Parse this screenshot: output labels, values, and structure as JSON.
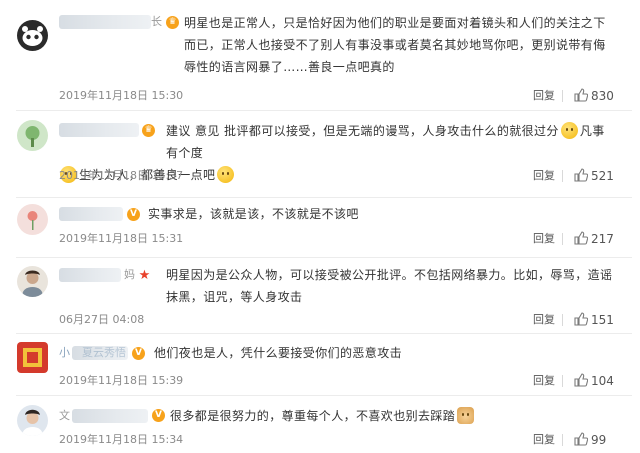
{
  "comments": [
    {
      "user_tail": "长",
      "text_parts": [
        "明星也是正常人，只是恰好因为他们的职业是要面对着镜头和人们的关注之下而已，正常人也接受不了别人有事没事或者莫名其妙地骂你吧，更别说带有侮辱性的语言网暴了……善良一点吧真的"
      ],
      "time": "2019年11月18日 15:30",
      "reply_label": "回复",
      "likes": "830"
    },
    {
      "user_tail": "",
      "text_parts": [
        "建议 意见 批评都可以接受，但是无端的谩骂，人身攻击什么的就很过分",
        "凡事有个度",
        "生为为人，都善良一点吧"
      ],
      "time": "2019年11月18日 15:37",
      "reply_label": "回复",
      "likes": "521"
    },
    {
      "user_tail": "",
      "text_parts": [
        "实事求是，该就是该，不该就是不该吧"
      ],
      "time": "2019年11月18日 15:31",
      "reply_label": "回复",
      "likes": "217"
    },
    {
      "user_tail": "妈",
      "text_parts": [
        "明星因为是公众人物，可以接受被公开批评。不包括网络暴力。比如，辱骂，造谣抹黑，诅咒，等人身攻击"
      ],
      "time": "06月27日 04:08",
      "reply_label": "回复",
      "likes": "151"
    },
    {
      "user_tail": "小",
      "user_mid": "夏云秀悟",
      "text_parts": [
        "他们夜也是人，凭什么要接受你们的恶意攻击"
      ],
      "time": "2019年11月18日 15:39",
      "reply_label": "回复",
      "likes": "104"
    },
    {
      "user_tail": "",
      "text_parts": [
        "很多都是很努力的，尊重每个人，不喜欢也别去踩踏"
      ],
      "time": "2019年11月18日 15:34",
      "reply_label": "回复",
      "likes": "99"
    }
  ],
  "colors": {
    "text": "#333333",
    "meta": "#8a8a8a",
    "separator": "#ececec",
    "badge_orange": "#f7a21b",
    "badge_red": "#e8412b"
  },
  "icons": {
    "like": "thumbs-up-icon",
    "vip": "v-badge-icon",
    "emoji": "emoji-icon"
  }
}
